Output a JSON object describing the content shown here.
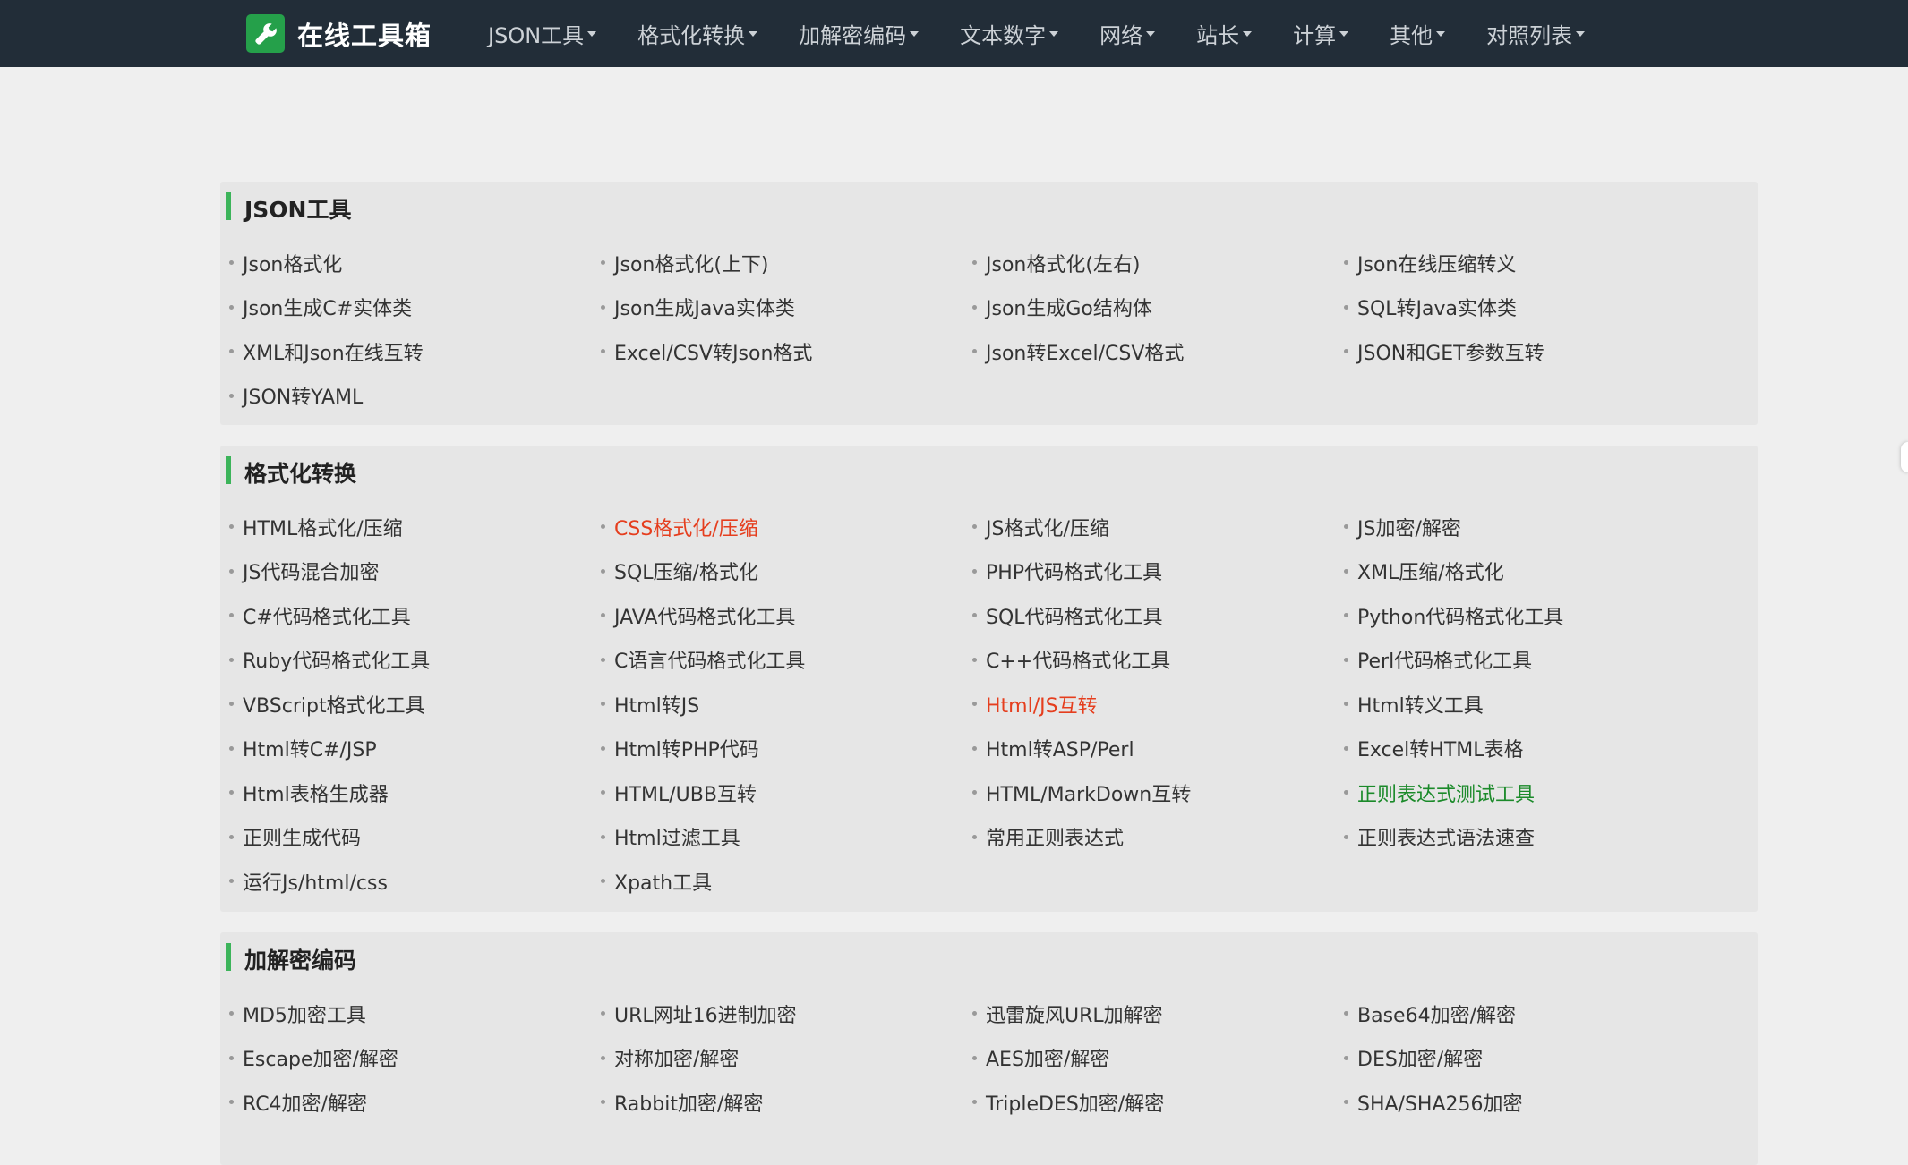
{
  "brand": {
    "title": "在线工具箱"
  },
  "nav": [
    "JSON工具",
    "格式化转换",
    "加解密编码",
    "文本数字",
    "网络",
    "站长",
    "计算",
    "其他",
    "对照列表"
  ],
  "sections": [
    {
      "title": "JSON工具",
      "links": [
        {
          "label": "Json格式化"
        },
        {
          "label": "Json格式化(上下)"
        },
        {
          "label": "Json格式化(左右)"
        },
        {
          "label": "Json在线压缩转义"
        },
        {
          "label": "Json生成C#实体类"
        },
        {
          "label": "Json生成Java实体类"
        },
        {
          "label": "Json生成Go结构体"
        },
        {
          "label": "SQL转Java实体类"
        },
        {
          "label": "XML和Json在线互转"
        },
        {
          "label": "Excel/CSV转Json格式"
        },
        {
          "label": "Json转Excel/CSV格式"
        },
        {
          "label": "JSON和GET参数互转"
        },
        {
          "label": "JSON转YAML"
        }
      ]
    },
    {
      "title": "格式化转换",
      "links": [
        {
          "label": "HTML格式化/压缩"
        },
        {
          "label": "CSS格式化/压缩",
          "color": "red"
        },
        {
          "label": "JS格式化/压缩"
        },
        {
          "label": "JS加密/解密"
        },
        {
          "label": "JS代码混合加密"
        },
        {
          "label": "SQL压缩/格式化"
        },
        {
          "label": "PHP代码格式化工具"
        },
        {
          "label": "XML压缩/格式化"
        },
        {
          "label": "C#代码格式化工具"
        },
        {
          "label": "JAVA代码格式化工具"
        },
        {
          "label": "SQL代码格式化工具"
        },
        {
          "label": "Python代码格式化工具"
        },
        {
          "label": "Ruby代码格式化工具"
        },
        {
          "label": "C语言代码格式化工具"
        },
        {
          "label": "C++代码格式化工具"
        },
        {
          "label": "Perl代码格式化工具"
        },
        {
          "label": "VBScript格式化工具"
        },
        {
          "label": "Html转JS"
        },
        {
          "label": "Html/JS互转",
          "color": "red"
        },
        {
          "label": "Html转义工具"
        },
        {
          "label": "Html转C#/JSP"
        },
        {
          "label": "Html转PHP代码"
        },
        {
          "label": "Html转ASP/Perl"
        },
        {
          "label": "Excel转HTML表格"
        },
        {
          "label": "Html表格生成器"
        },
        {
          "label": "HTML/UBB互转"
        },
        {
          "label": "HTML/MarkDown互转"
        },
        {
          "label": "正则表达式测试工具",
          "color": "green"
        },
        {
          "label": "正则生成代码"
        },
        {
          "label": "Html过滤工具"
        },
        {
          "label": "常用正则表达式"
        },
        {
          "label": "正则表达式语法速查"
        },
        {
          "label": "运行Js/html/css"
        },
        {
          "label": "Xpath工具"
        }
      ]
    },
    {
      "title": "加解密编码",
      "links": [
        {
          "label": "MD5加密工具"
        },
        {
          "label": "URL网址16进制加密"
        },
        {
          "label": "迅雷旋风URL加解密"
        },
        {
          "label": "Base64加密/解密"
        },
        {
          "label": "Escape加密/解密"
        },
        {
          "label": "对称加密/解密"
        },
        {
          "label": "AES加密/解密"
        },
        {
          "label": "DES加密/解密"
        },
        {
          "label": "RC4加密/解密"
        },
        {
          "label": "Rabbit加密/解密"
        },
        {
          "label": "TripleDES加密/解密"
        },
        {
          "label": "SHA/SHA256加密"
        }
      ]
    }
  ],
  "colors": {
    "navbar": "#222d38",
    "accent": "#3cb45a",
    "red": "#e53e1e",
    "green": "#1b8a2a"
  },
  "icons": {
    "brand": "wrench-icon"
  }
}
